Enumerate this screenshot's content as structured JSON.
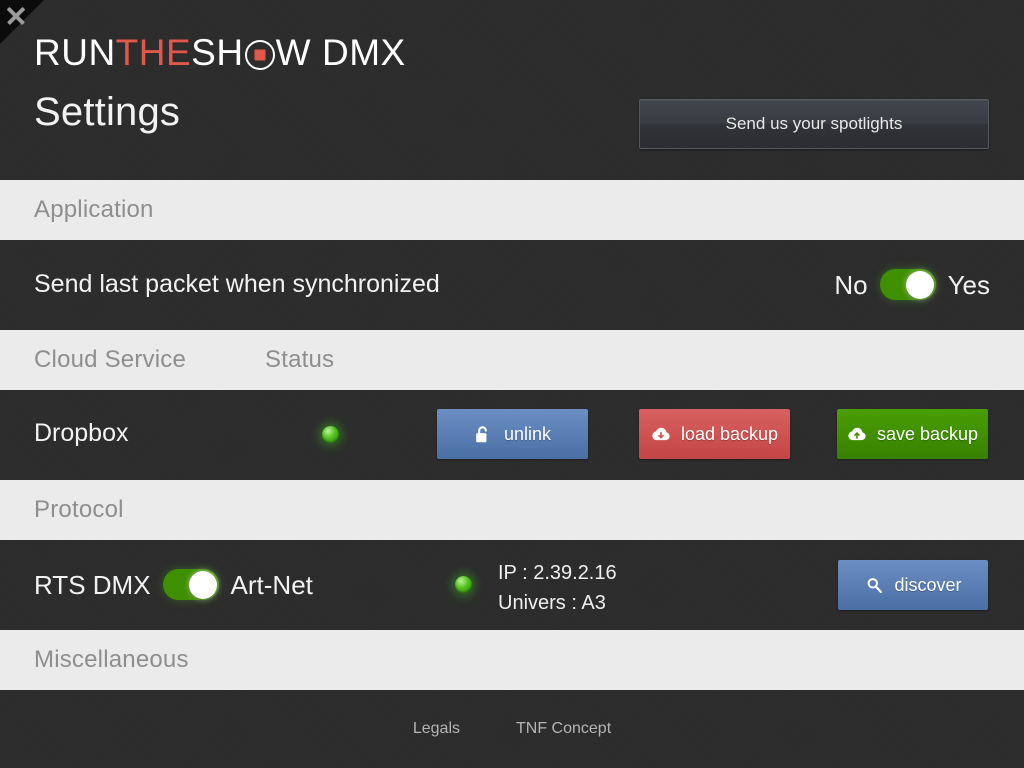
{
  "window": {
    "close_icon": "close-x-icon"
  },
  "header": {
    "logo": {
      "part1": "RUN",
      "part2": "THE",
      "part3": "SH",
      "o_mark": "logo-o-mark-icon",
      "part4": "W",
      "part5": "DMX"
    },
    "title": "Settings",
    "spotlights_button": "Send us your spotlights"
  },
  "sections": {
    "application": {
      "band_title": "Application",
      "row": {
        "label": "Send last packet when synchronized",
        "toggle": {
          "left_label": "No",
          "right_label": "Yes",
          "state": "on"
        }
      }
    },
    "cloud_service": {
      "band_title": "Cloud Service",
      "band_title_secondary": "Status",
      "row": {
        "label": "Dropbox",
        "status_led": "status-led-green",
        "buttons": [
          {
            "label": "unlink",
            "icon": "unlock-icon",
            "color": "blue"
          },
          {
            "label": "load backup",
            "icon": "cloud-download-icon",
            "color": "red"
          },
          {
            "label": "save backup",
            "icon": "cloud-upload-icon",
            "color": "green"
          }
        ]
      }
    },
    "protocol": {
      "band_title": "Protocol",
      "row": {
        "left_label": "RTS DMX",
        "right_label": "Art-Net",
        "toggle_state": "on",
        "status_led": "status-led-green",
        "ip_line": "IP : 2.39.2.16",
        "universe_line": "Univers : A3",
        "discover_button": {
          "label": "discover",
          "icon": "search-icon",
          "color": "blue"
        }
      }
    },
    "miscellaneous": {
      "band_title": "Miscellaneous"
    }
  },
  "footer": {
    "links": [
      {
        "label": "Legals"
      },
      {
        "label": "TNF Concept"
      }
    ]
  },
  "colors": {
    "background_dark": "#2b2b2b",
    "band_light": "#ebebeb",
    "accent_red": "#e0574b",
    "toggle_green": "#3f9000",
    "button_blue": "#5b7fb4",
    "button_red": "#cf5353",
    "button_green": "#409000",
    "band_text": "#8e8e8e"
  }
}
